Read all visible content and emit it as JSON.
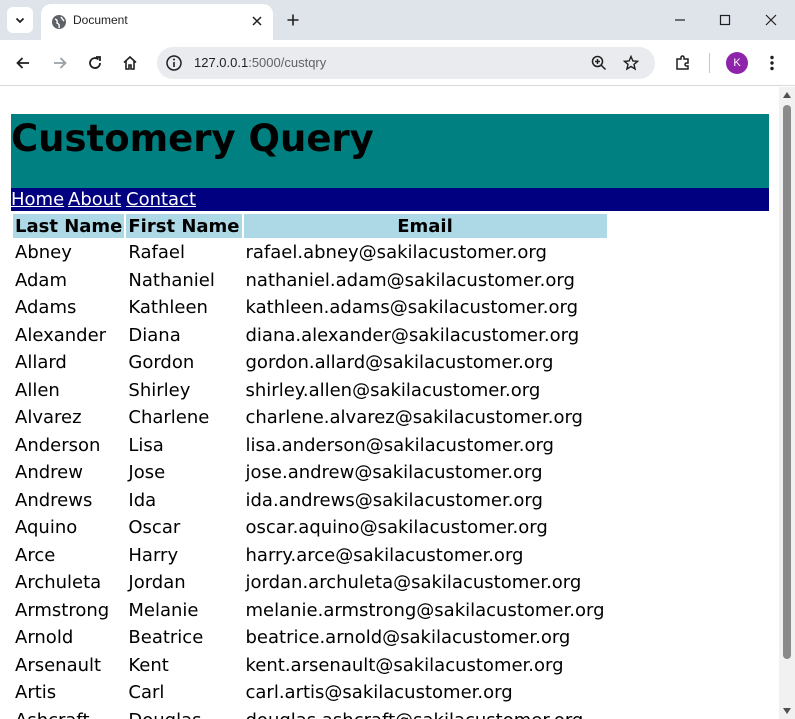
{
  "browser": {
    "tab_title": "Document",
    "url_host": "127.0.0.1",
    "url_rest": ":5000/custqry",
    "profile_initial": "K"
  },
  "page": {
    "title": "Customery Query",
    "nav": [
      "Home",
      "About",
      "Contact"
    ],
    "columns": [
      "Last Name",
      "First Name",
      "Email"
    ],
    "rows": [
      [
        "Abney",
        "Rafael",
        "rafael.abney@sakilacustomer.org"
      ],
      [
        "Adam",
        "Nathaniel",
        "nathaniel.adam@sakilacustomer.org"
      ],
      [
        "Adams",
        "Kathleen",
        "kathleen.adams@sakilacustomer.org"
      ],
      [
        "Alexander",
        "Diana",
        "diana.alexander@sakilacustomer.org"
      ],
      [
        "Allard",
        "Gordon",
        "gordon.allard@sakilacustomer.org"
      ],
      [
        "Allen",
        "Shirley",
        "shirley.allen@sakilacustomer.org"
      ],
      [
        "Alvarez",
        "Charlene",
        "charlene.alvarez@sakilacustomer.org"
      ],
      [
        "Anderson",
        "Lisa",
        "lisa.anderson@sakilacustomer.org"
      ],
      [
        "Andrew",
        "Jose",
        "jose.andrew@sakilacustomer.org"
      ],
      [
        "Andrews",
        "Ida",
        "ida.andrews@sakilacustomer.org"
      ],
      [
        "Aquino",
        "Oscar",
        "oscar.aquino@sakilacustomer.org"
      ],
      [
        "Arce",
        "Harry",
        "harry.arce@sakilacustomer.org"
      ],
      [
        "Archuleta",
        "Jordan",
        "jordan.archuleta@sakilacustomer.org"
      ],
      [
        "Armstrong",
        "Melanie",
        "melanie.armstrong@sakilacustomer.org"
      ],
      [
        "Arnold",
        "Beatrice",
        "beatrice.arnold@sakilacustomer.org"
      ],
      [
        "Arsenault",
        "Kent",
        "kent.arsenault@sakilacustomer.org"
      ],
      [
        "Artis",
        "Carl",
        "carl.artis@sakilacustomer.org"
      ],
      [
        "Ashcraft",
        "Douglas",
        "douglas.ashcraft@sakilacustomer.org"
      ]
    ]
  },
  "colors": {
    "header_bg": "#008080",
    "nav_bg": "#000080",
    "table_header_bg": "#add8e6"
  },
  "icons": [
    "tab-list-icon",
    "globe-icon",
    "close-icon",
    "plus-icon",
    "minimize-icon",
    "maximize-icon",
    "back-icon",
    "forward-icon",
    "reload-icon",
    "home-icon",
    "info-icon",
    "zoom-icon",
    "star-icon",
    "extensions-icon",
    "menu-icon"
  ]
}
